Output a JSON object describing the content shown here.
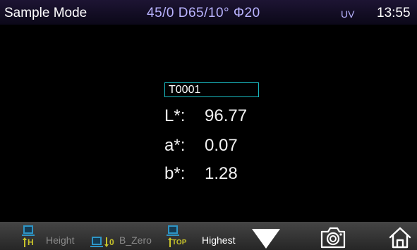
{
  "status": {
    "mode_title": "Sample Mode",
    "geometry": "45/0  D65/10°  Φ20",
    "uv_label": "UV",
    "time": "13:55"
  },
  "sample": {
    "name": "T0001",
    "rows": [
      {
        "label": "L*:",
        "value": "96.77"
      },
      {
        "label": "a*:",
        "value": "0.07"
      },
      {
        "label": "b*:",
        "value": "1.28"
      }
    ]
  },
  "toolbar": {
    "height_label": "Height",
    "b_zero_label": "B_Zero",
    "highest_label": "Highest",
    "h_icon_text": "H",
    "zero_icon_text": "0",
    "top_icon_text": "TOP",
    "icons": [
      "height-icon",
      "b-zero-icon",
      "top-icon",
      "dropdown-triangle-icon",
      "camera-icon",
      "home-icon"
    ]
  },
  "colors": {
    "accent_cyan": "#19b9c0",
    "icon_blue": "#2d95c6",
    "icon_yellow": "#c9c42a",
    "status_text_blue": "#b9b3ff"
  }
}
